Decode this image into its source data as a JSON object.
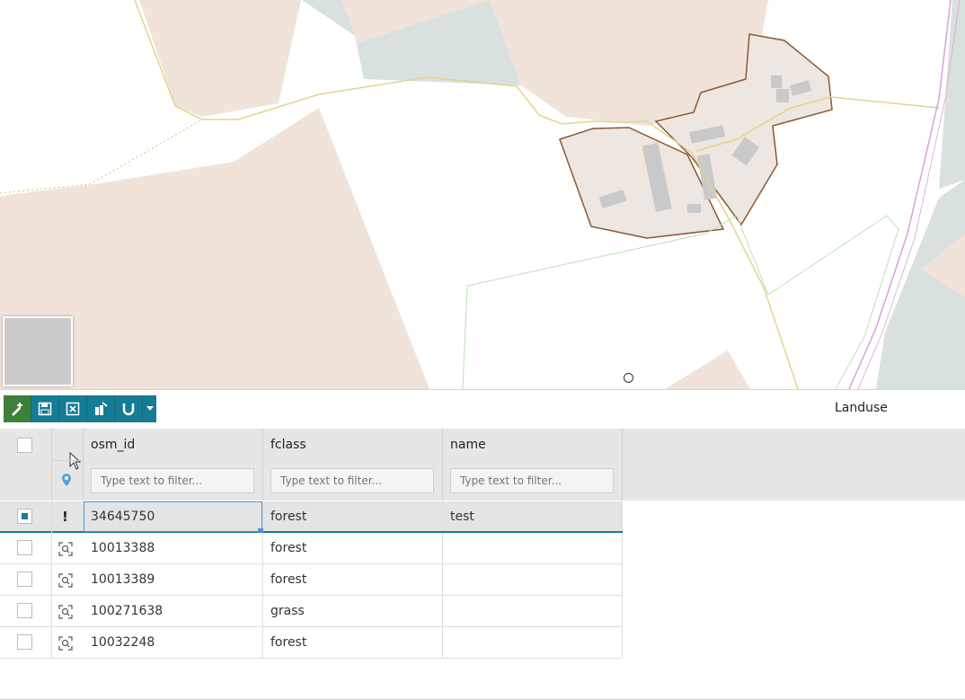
{
  "map": {
    "overview_icon": "overview-map",
    "colors": {
      "landuse_fill": "#f1e3da",
      "building": "#c9c9c9",
      "outline": "#8a5a34",
      "road": "#e8d97a",
      "grass": "#d9e1de"
    }
  },
  "toolbar": {
    "buttons": [
      {
        "icon": "draw-point-icon",
        "active": true
      },
      {
        "icon": "save-icon"
      },
      {
        "icon": "discard-icon"
      },
      {
        "icon": "multi-edit-icon"
      },
      {
        "icon": "snap-magnet-icon"
      },
      {
        "icon": "chevron-down-icon"
      }
    ],
    "accent": "#157c95"
  },
  "layer": {
    "title": "Landuse"
  },
  "grid": {
    "columns": [
      {
        "key": "osm_id",
        "label": "osm_id",
        "filter_placeholder": "Type text to filter..."
      },
      {
        "key": "fclass",
        "label": "fclass",
        "filter_placeholder": "Type text to filter..."
      },
      {
        "key": "name",
        "label": "name",
        "filter_placeholder": "Type text to filter..."
      }
    ],
    "rows": [
      {
        "osm_id": "34645750",
        "fclass": "forest",
        "name": "test",
        "selected": true,
        "status": "!"
      },
      {
        "osm_id": "10013388",
        "fclass": "forest",
        "name": "",
        "selected": false
      },
      {
        "osm_id": "10013389",
        "fclass": "forest",
        "name": "",
        "selected": false
      },
      {
        "osm_id": "100271638",
        "fclass": "grass",
        "name": "",
        "selected": false
      },
      {
        "osm_id": "10032248",
        "fclass": "forest",
        "name": "",
        "selected": false
      }
    ]
  }
}
